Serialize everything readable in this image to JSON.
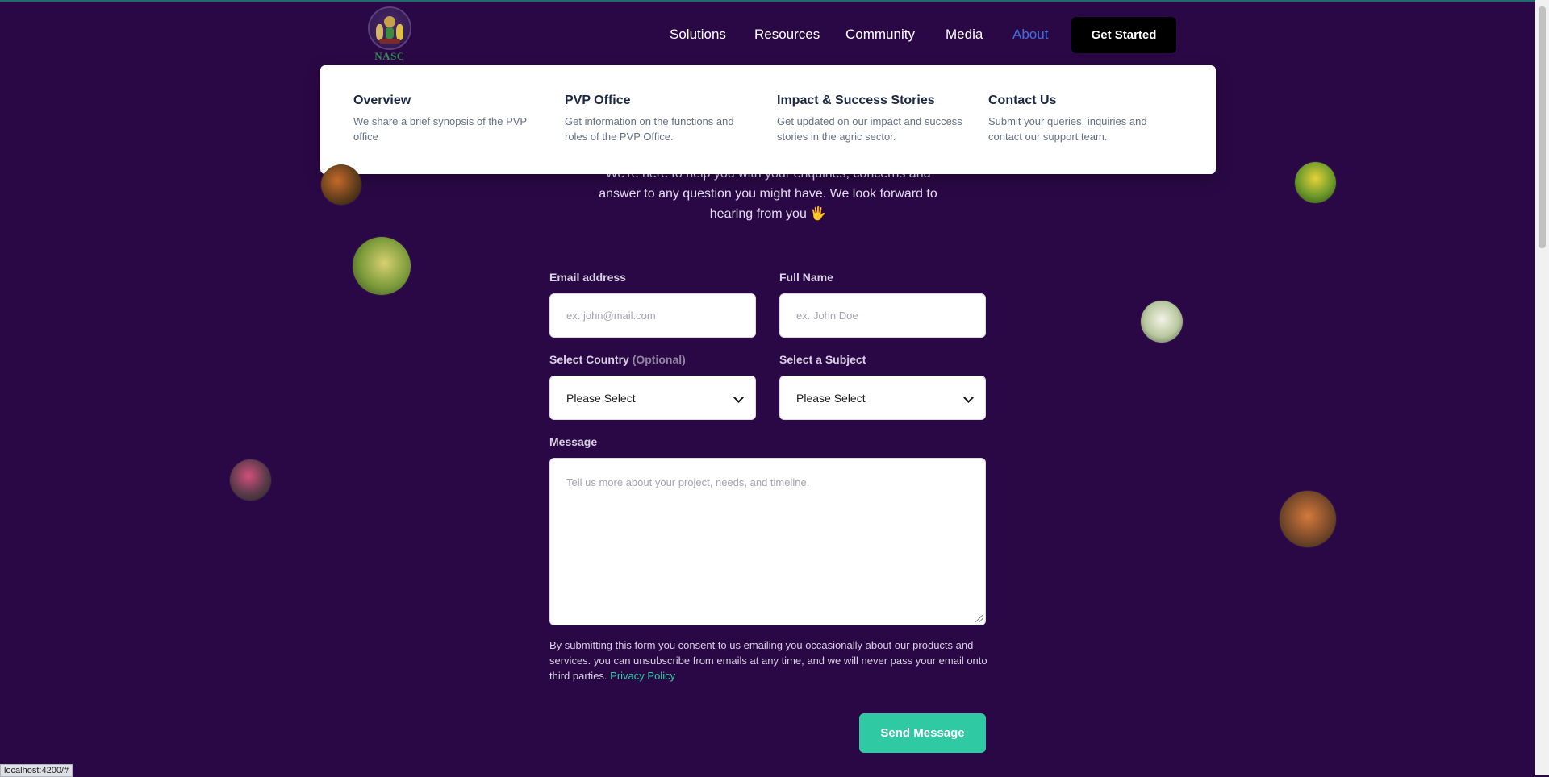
{
  "header": {
    "logo_text": "NASC",
    "nav": [
      {
        "label": "Solutions"
      },
      {
        "label": "Resources"
      },
      {
        "label": "Community"
      },
      {
        "label": "Media"
      },
      {
        "label": "About",
        "active": true
      }
    ],
    "cta_label": "Get Started"
  },
  "about_menu": {
    "items": [
      {
        "title": "Overview",
        "desc": "We share a brief synopsis of the PVP office"
      },
      {
        "title": "PVP Office",
        "desc": "Get information on the functions and roles of the PVP Office."
      },
      {
        "title": "Impact & Success Stories",
        "desc": "Get updated on our impact and success stories in the agric sector."
      },
      {
        "title": "Contact Us",
        "desc": "Submit your queries, inquiries and contact our support team."
      }
    ]
  },
  "intro": {
    "line1": "We're here to help you with your enquiries, concerns and",
    "line2": "answer to any question you might have. We look forward to",
    "line3": "hearing from you 🖐"
  },
  "form": {
    "email": {
      "label": "Email address",
      "placeholder": "ex. john@mail.com",
      "value": ""
    },
    "name": {
      "label": "Full Name",
      "placeholder": "ex. John Doe",
      "value": ""
    },
    "country": {
      "label": "Select Country",
      "optional": "(Optional)",
      "selected": "Please Select"
    },
    "subject": {
      "label": "Select a Subject",
      "selected": "Please Select"
    },
    "message": {
      "label": "Message",
      "placeholder": "Tell us more about your project, needs, and timeline.",
      "value": ""
    },
    "consent_text": "By submitting this form you consent to us emailing you occasionally about our products and services. you can unsubscribe from emails at any time, and we will never pass your email onto third parties.",
    "privacy_link": "Privacy Policy",
    "submit_label": "Send Message"
  },
  "status_bar": "localhost:4200/#",
  "colors": {
    "background": "#2a0845",
    "accent_teal": "#2fc9a4",
    "nav_active": "#3f6ee0",
    "menu_title": "#1a2742"
  }
}
